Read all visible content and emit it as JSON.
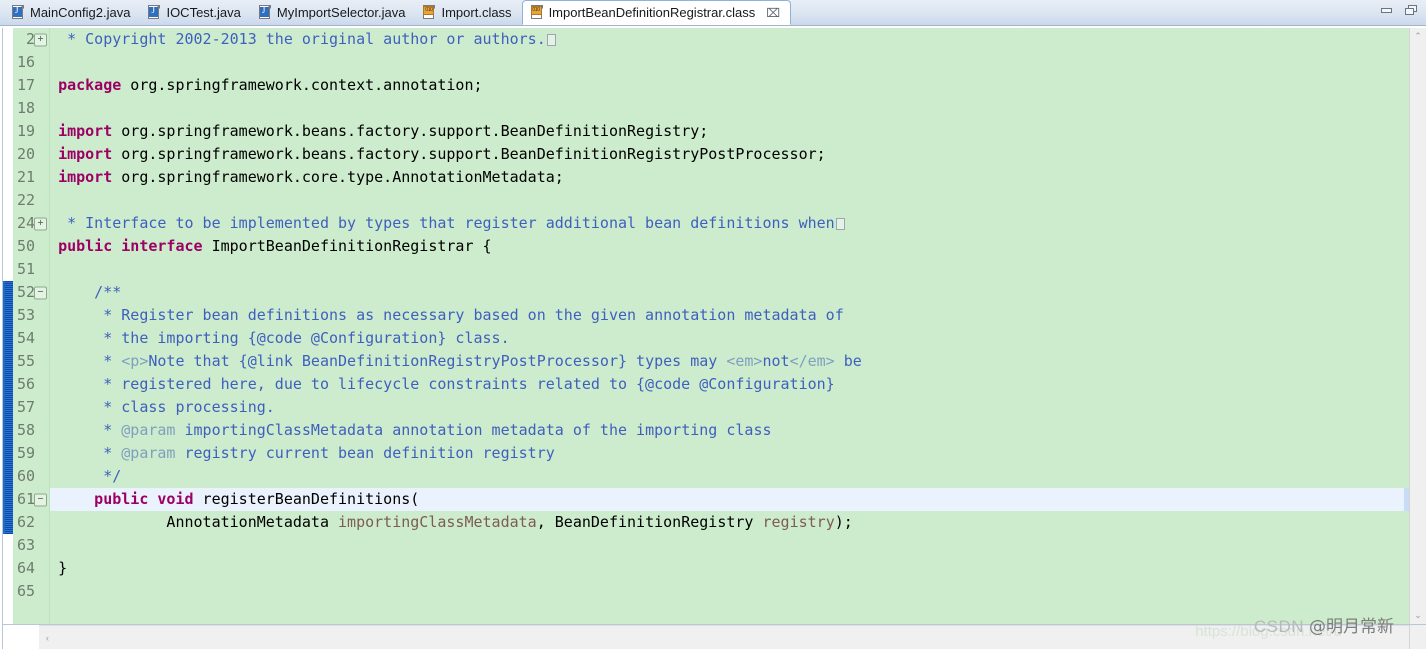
{
  "window": {
    "minimize_label": "Minimize",
    "maximize_label": "Restore"
  },
  "tabs": [
    {
      "label": "MainConfig2.java",
      "icon": "java-file-icon",
      "type": "java",
      "active": false,
      "closable": false
    },
    {
      "label": "IOCTest.java",
      "icon": "java-file-icon",
      "type": "java",
      "active": false,
      "closable": false
    },
    {
      "label": "MyImportSelector.java",
      "icon": "java-file-icon",
      "type": "java",
      "active": false,
      "closable": false
    },
    {
      "label": "Import.class",
      "icon": "class-file-icon",
      "type": "class",
      "active": false,
      "closable": false
    },
    {
      "label": "ImportBeanDefinitionRegistrar.class",
      "icon": "class-file-icon",
      "type": "class",
      "active": true,
      "closable": true,
      "close_glyph": "⌧"
    }
  ],
  "editor": {
    "language": "java",
    "background_color": "#CDECCD",
    "current_line_color": "#EAF2FD",
    "gutter_color": "#CDECCD",
    "keyword_color": "#9C0064",
    "comment_color": "#3F5FBF",
    "javadoc_tag_color": "#7F9FBF",
    "parameter_color": "#7D5C52",
    "lines": [
      {
        "num": "2",
        "fold": "plus",
        "current": false,
        "collapsed_marker": true,
        "tokens": [
          {
            "t": "cmt",
            "v": " * Copyright 2002-2013 the original author or authors."
          }
        ]
      },
      {
        "num": "16",
        "fold": null,
        "current": false,
        "tokens": []
      },
      {
        "num": "17",
        "fold": null,
        "current": false,
        "tokens": [
          {
            "t": "kw",
            "v": "package"
          },
          {
            "t": "plain",
            "v": " org.springframework.context.annotation;"
          }
        ]
      },
      {
        "num": "18",
        "fold": null,
        "current": false,
        "tokens": []
      },
      {
        "num": "19",
        "fold": null,
        "current": false,
        "tokens": [
          {
            "t": "kw",
            "v": "import"
          },
          {
            "t": "plain",
            "v": " org.springframework.beans.factory.support.BeanDefinitionRegistry;"
          }
        ]
      },
      {
        "num": "20",
        "fold": null,
        "current": false,
        "tokens": [
          {
            "t": "kw",
            "v": "import"
          },
          {
            "t": "plain",
            "v": " org.springframework.beans.factory.support.BeanDefinitionRegistryPostProcessor;"
          }
        ]
      },
      {
        "num": "21",
        "fold": null,
        "current": false,
        "tokens": [
          {
            "t": "kw",
            "v": "import"
          },
          {
            "t": "plain",
            "v": " org.springframework.core.type.AnnotationMetadata;"
          }
        ]
      },
      {
        "num": "22",
        "fold": null,
        "current": false,
        "tokens": []
      },
      {
        "num": "24",
        "fold": "plus",
        "current": false,
        "collapsed_marker": true,
        "tokens": [
          {
            "t": "cmt",
            "v": " * Interface to be implemented by types that register additional bean definitions when"
          }
        ]
      },
      {
        "num": "50",
        "fold": null,
        "current": false,
        "tokens": [
          {
            "t": "kw",
            "v": "public interface"
          },
          {
            "t": "plain",
            "v": " ImportBeanDefinitionRegistrar {"
          }
        ]
      },
      {
        "num": "51",
        "fold": null,
        "current": false,
        "tokens": []
      },
      {
        "num": "52",
        "fold": "minus",
        "current": false,
        "tokens": [
          {
            "t": "cmt",
            "v": "    /**"
          }
        ]
      },
      {
        "num": "53",
        "fold": null,
        "current": false,
        "tokens": [
          {
            "t": "cmt",
            "v": "     * Register bean definitions as necessary based on the given annotation metadata of"
          }
        ]
      },
      {
        "num": "54",
        "fold": null,
        "current": false,
        "tokens": [
          {
            "t": "cmt",
            "v": "     * the importing {@code @Configuration} class."
          }
        ]
      },
      {
        "num": "55",
        "fold": null,
        "current": false,
        "tokens": [
          {
            "t": "cmt",
            "v": "     * "
          },
          {
            "t": "cmt-tag",
            "v": "<p>"
          },
          {
            "t": "cmt",
            "v": "Note that {@link BeanDefinitionRegistryPostProcessor} types may "
          },
          {
            "t": "cmt-tag",
            "v": "<em>"
          },
          {
            "t": "cmt",
            "v": "not"
          },
          {
            "t": "cmt-tag",
            "v": "</em>"
          },
          {
            "t": "cmt",
            "v": " be"
          }
        ]
      },
      {
        "num": "56",
        "fold": null,
        "current": false,
        "tokens": [
          {
            "t": "cmt",
            "v": "     * registered here, due to lifecycle constraints related to {@code @Configuration}"
          }
        ]
      },
      {
        "num": "57",
        "fold": null,
        "current": false,
        "tokens": [
          {
            "t": "cmt",
            "v": "     * class processing."
          }
        ]
      },
      {
        "num": "58",
        "fold": null,
        "current": false,
        "tokens": [
          {
            "t": "cmt",
            "v": "     * "
          },
          {
            "t": "cmt-tag",
            "v": "@param"
          },
          {
            "t": "cmt",
            "v": " importingClassMetadata annotation metadata of the importing class"
          }
        ]
      },
      {
        "num": "59",
        "fold": null,
        "current": false,
        "tokens": [
          {
            "t": "cmt",
            "v": "     * "
          },
          {
            "t": "cmt-tag",
            "v": "@param"
          },
          {
            "t": "cmt",
            "v": " registry current bean definition registry"
          }
        ]
      },
      {
        "num": "60",
        "fold": null,
        "current": false,
        "tokens": [
          {
            "t": "cmt",
            "v": "     */"
          }
        ]
      },
      {
        "num": "61",
        "fold": "minus",
        "current": true,
        "tokens": [
          {
            "t": "kw",
            "v": "    public void"
          },
          {
            "t": "plain",
            "v": " registerBeanDefinitions("
          }
        ]
      },
      {
        "num": "62",
        "fold": null,
        "current": false,
        "tokens": [
          {
            "t": "plain",
            "v": "            AnnotationMetadata "
          },
          {
            "t": "param",
            "v": "importingClassMetadata"
          },
          {
            "t": "plain",
            "v": ", BeanDefinitionRegistry "
          },
          {
            "t": "param",
            "v": "registry"
          },
          {
            "t": "plain",
            "v": ");"
          }
        ]
      },
      {
        "num": "63",
        "fold": null,
        "current": false,
        "tokens": []
      },
      {
        "num": "64",
        "fold": null,
        "current": false,
        "tokens": [
          {
            "t": "plain",
            "v": "}"
          }
        ]
      },
      {
        "num": "65",
        "fold": null,
        "current": false,
        "tokens": []
      }
    ]
  },
  "scrollbars": {
    "vertical_up_arrow": "⌃",
    "vertical_down_arrow": "⌄",
    "horizontal_left_arrow": "‹",
    "horizontal_right_arrow": "›"
  },
  "watermark": {
    "url": "https://blog.csdn.net/u",
    "brand": "CSDN",
    "author": "@明月常新"
  }
}
